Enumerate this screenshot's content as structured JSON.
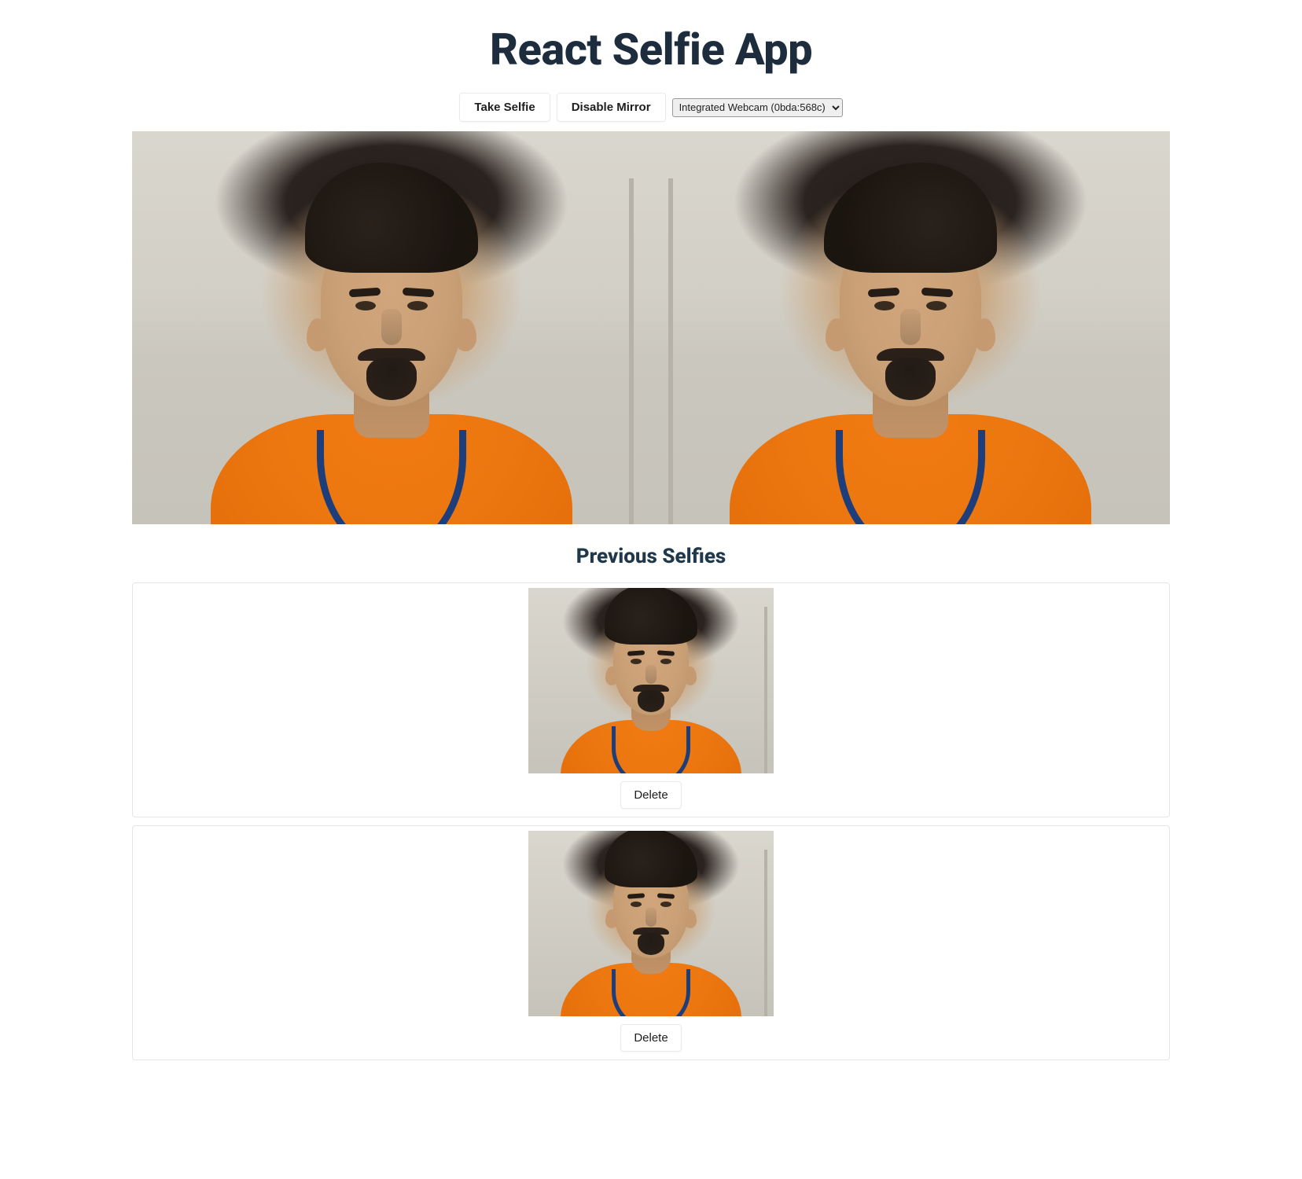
{
  "title": "React Selfie App",
  "controls": {
    "take_selfie_label": "Take Selfie",
    "mirror_toggle_label": "Disable Mirror",
    "camera_select_value": "Integrated Webcam (0bda:568c)",
    "camera_options": [
      "Integrated Webcam (0bda:568c)"
    ]
  },
  "section": {
    "previous_selfies_heading": "Previous Selfies"
  },
  "selfies": [
    {
      "delete_label": "Delete"
    },
    {
      "delete_label": "Delete"
    }
  ]
}
